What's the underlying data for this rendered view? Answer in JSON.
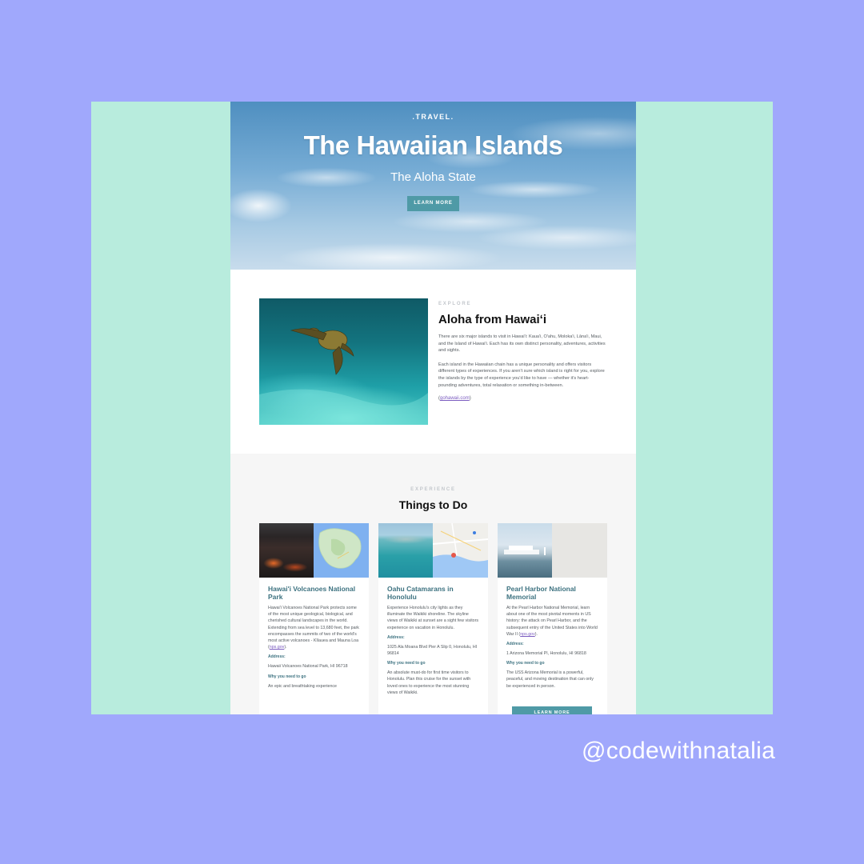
{
  "hero": {
    "eyebrow": ".TRAVEL.",
    "title": "The Hawaiian Islands",
    "subtitle": "The Aloha State",
    "button": "LEARN MORE"
  },
  "explore": {
    "eyebrow": "EXPLORE",
    "title": "Aloha from Hawaiʻi",
    "paragraph1": "There are six major islands to visit in Hawai'i: Kaua'i, O'ahu, Moloka'i, Lāna'i, Maui, and the Island of Hawai'i. Each has its own distinct personality, adventures, activities and sights.",
    "paragraph2": "Each island in the Hawaiian chain has a unique personality and offers visitors different types of experiences. If you aren't sure which island is right for you, explore the islands by the type of experience you'd like to have — whether it's heart-pounding adventures, total relaxation or something in-between.",
    "source": "gohawaii.com"
  },
  "experience": {
    "eyebrow": "EXPERIENCE",
    "title": "Things to Do",
    "cards": [
      {
        "title": "Hawai'i Volcanoes National Park",
        "description": "Hawai'i Volcanoes National Park protects some of the most unique geological, biological, and cherished cultural landscapes in the world. Extending from sea level to 13,680 feet, the park encompasses the summits of two of the world's most active volcanoes - Kīlauea and Mauna Loa",
        "source": "nps.gov",
        "address_label": "Address:",
        "address": "Hawaii Volcanoes National Park, HI 96718",
        "why_label": "Why you need to go",
        "why": "An epic and breathtaking experience"
      },
      {
        "title": "Oahu Catamarans in Honolulu",
        "description": "Experience Honolulu's city lights as they illuminate the Waikiki shoreline. The skyline views of Waikiki at sunset are a sight few visitors experience on vacation in Honolulu.",
        "address_label": "Address:",
        "address": "1025 Ala Moana Blvd Pier A Slip 0, Honolulu, HI 96814",
        "why_label": "Why you need to go",
        "why": "An absolute must-do for first time visitors to Honolulu. Plan this cruise for the sunset with loved ones to experience the most stunning views of Waikiki."
      },
      {
        "title": "Pearl Harbor National Memorial",
        "description": "At the Pearl Harbor National Memorial, learn about one of the most pivotal moments in US history: the attack on Pearl Harbor, and the subsequent entry of the United States into World War II",
        "source": "nps.gov",
        "address_label": "Address:",
        "address": "1 Arizona Memorial Pl, Honolulu, HI 96818",
        "why_label": "Why you need to go",
        "why": "The USS Arizona Memorial is a powerful, peaceful, and moving destination that can only be experienced in person.",
        "button": "LEARN MORE"
      }
    ]
  },
  "handle": "@codewithnatalia",
  "colors": {
    "background": "#a0a8fc",
    "mint": "#b8ecdd",
    "accent": "#4f9aa6",
    "card_title": "#3d7280",
    "link": "#7b5cc0"
  }
}
